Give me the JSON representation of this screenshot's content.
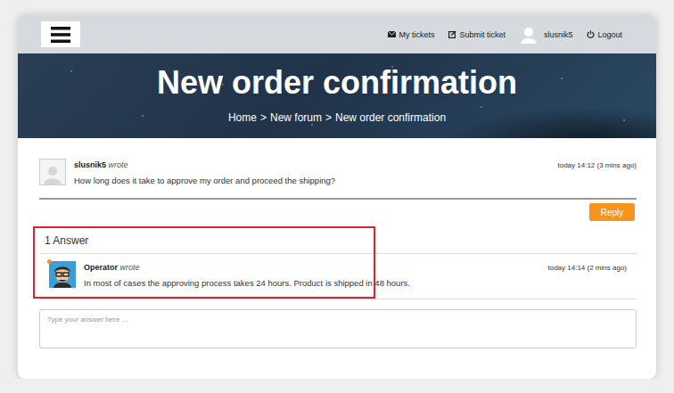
{
  "header": {
    "my_tickets": "My tickets",
    "submit_ticket": "Submit ticket",
    "username": "slusnik5",
    "logout": "Logout"
  },
  "hero": {
    "title": "New order confirmation",
    "breadcrumb": [
      "Home",
      "New forum",
      "New order confirmation"
    ],
    "separator": ">"
  },
  "question": {
    "author": "slusnik5",
    "verb": "wrote",
    "time": "today 14:12 (3 mins ago)",
    "body": "How long does it take to approve my order and proceed the shipping?"
  },
  "reply_button": "Reply",
  "answers": {
    "heading": "1 Answer",
    "items": [
      {
        "author": "Operator",
        "verb": "wrote",
        "time": "today 14:14 (2 mins ago)",
        "body": "In most of cases the approving process takes 24 hours. Product is shipped in 48 hours.",
        "online": true
      }
    ]
  },
  "answer_input": {
    "placeholder": "Type your answer here ..."
  }
}
